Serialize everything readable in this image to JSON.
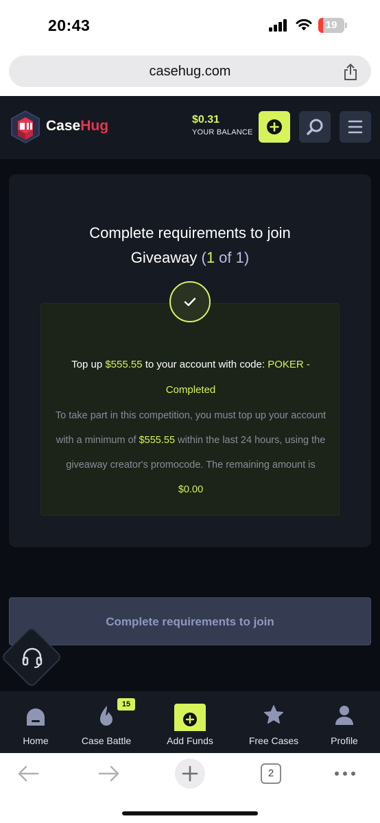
{
  "status_bar": {
    "time": "20:43",
    "battery": "19",
    "battery_level": 0.19
  },
  "browser": {
    "url": "casehug.com",
    "tab_count": "2"
  },
  "header": {
    "brand_part1": "Case",
    "brand_part2": "Hug",
    "balance_amount": "$0.31",
    "balance_label": "YOUR BALANCE",
    "colors": {
      "accent": "#d6f35a",
      "brand_red": "#e8344e",
      "panel": "#141821"
    },
    "icons": [
      "plus-circle-icon",
      "search-icon",
      "hamburger-icon"
    ]
  },
  "giveaway": {
    "title_line1": "Complete requirements to join",
    "title_line2": "Giveaway",
    "count_open": "(",
    "count_current": "1",
    "count_of": " of ",
    "count_total": "1",
    "count_close": ")",
    "requirement": {
      "pre": "Top up ",
      "amount": "$555.55",
      "mid": " to your account with code: ",
      "code": "POKER",
      "dash": " -",
      "status": "Completed",
      "desc_pre": "To take part in this competition, you must top up your account with a minimum of ",
      "desc_amount": "$555.55",
      "desc_mid": " within the last 24 hours, using the giveaway creator's promocode. The remaining amount is ",
      "desc_remaining": "$0.00"
    }
  },
  "join_button": {
    "label": "Complete requirements to join"
  },
  "bottom_nav": {
    "items": [
      {
        "label": "Home",
        "icon": "home-icon"
      },
      {
        "label": "Case Battle",
        "icon": "flame-icon",
        "badge": "15"
      },
      {
        "label": "Add Funds",
        "icon": "plus-circle-icon"
      },
      {
        "label": "Free Cases",
        "icon": "star-icon"
      },
      {
        "label": "Profile",
        "icon": "user-icon"
      }
    ]
  }
}
